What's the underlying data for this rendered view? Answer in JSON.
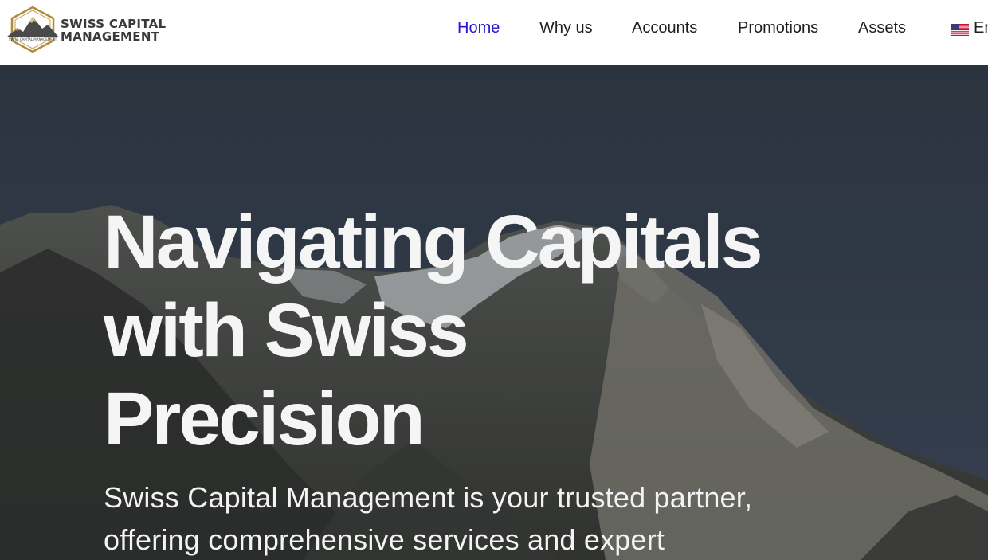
{
  "brand": {
    "line1": "SWISS CAPITAL",
    "line2": "MANAGEMENT",
    "badge_text": "SWISS CAPITAL MANAGEMENT",
    "colors": {
      "gold": "#b38a3c",
      "dark": "#3a3a3a"
    }
  },
  "nav": {
    "items": [
      {
        "label": "Home",
        "active": true
      },
      {
        "label": "Why us"
      },
      {
        "label": "Accounts"
      },
      {
        "label": "Promotions"
      },
      {
        "label": "Assets"
      }
    ],
    "language": {
      "label": "En",
      "flag_icon": "us-flag-icon"
    },
    "active_color": "#2a14d6"
  },
  "hero": {
    "title_lines": [
      "Navigating Capitals",
      "with Swiss",
      "Precision"
    ],
    "subtitle_lines": [
      "Swiss Capital Management is your trusted partner,",
      "offering comprehensive services and expert"
    ],
    "background": "mountain-photo"
  }
}
